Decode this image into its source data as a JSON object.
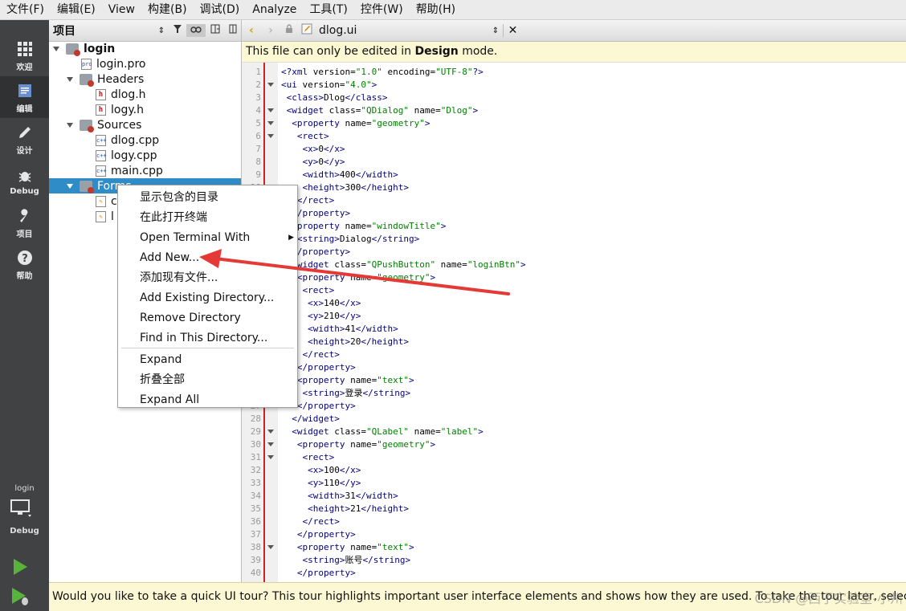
{
  "menubar": [
    "文件(F)",
    "编辑(E)",
    "View",
    "构建(B)",
    "调试(D)",
    "Analyze",
    "工具(T)",
    "控件(W)",
    "帮助(H)"
  ],
  "modes": [
    {
      "label": "欢迎",
      "icon": "grid-icon"
    },
    {
      "label": "编辑",
      "icon": "edit-icon"
    },
    {
      "label": "设计",
      "icon": "pencil-icon"
    },
    {
      "label": "Debug",
      "icon": "bug-icon"
    },
    {
      "label": "项目",
      "icon": "wrench-icon"
    },
    {
      "label": "帮助",
      "icon": "help-icon"
    }
  ],
  "kit": {
    "project": "login",
    "config": "Debug"
  },
  "project_pane": {
    "title": "项目"
  },
  "tree": [
    {
      "label": "login",
      "kind": "project"
    },
    {
      "label": "login.pro",
      "kind": "pro"
    },
    {
      "label": "Headers",
      "kind": "folder"
    },
    {
      "label": "dlog.h",
      "kind": "h"
    },
    {
      "label": "logy.h",
      "kind": "h"
    },
    {
      "label": "Sources",
      "kind": "folder"
    },
    {
      "label": "dlog.cpp",
      "kind": "cpp"
    },
    {
      "label": "logy.cpp",
      "kind": "cpp"
    },
    {
      "label": "main.cpp",
      "kind": "cpp"
    },
    {
      "label": "Forms",
      "kind": "folder"
    },
    {
      "label": "c",
      "kind": "ui"
    },
    {
      "label": "l",
      "kind": "ui"
    }
  ],
  "editor_tab": {
    "filename": "dlog.ui"
  },
  "infobar": {
    "prefix": "This file can only be edited in ",
    "bold": "Design",
    "suffix": " mode."
  },
  "context_menu": [
    "显示包含的目录",
    "在此打开终端",
    "Open Terminal With",
    "Add New...",
    "添加现有文件...",
    "Add Existing Directory...",
    "Remove Directory",
    "Find in This Directory...",
    "Expand",
    "折叠全部",
    "Expand All"
  ],
  "code_lines": [
    "<?xml version=\"1.0\" encoding=\"UTF-8\"?>",
    "<ui version=\"4.0\">",
    " <class>Dlog</class>",
    " <widget class=\"QDialog\" name=\"Dlog\">",
    "  <property name=\"geometry\">",
    "   <rect>",
    "    <x>0</x>",
    "    <y>0</y>",
    "    <width>400</width>",
    "    <height>300</height>",
    "   </rect>",
    "  </property>",
    "  <property name=\"windowTitle\">",
    "   <string>Dialog</string>",
    "  </property>",
    "  <widget class=\"QPushButton\" name=\"loginBtn\">",
    "   <property name=\"geometry\">",
    "    <rect>",
    "     <x>140</x>",
    "     <y>210</y>",
    "     <width>41</width>",
    "     <height>20</height>",
    "    </rect>",
    "   </property>",
    "   <property name=\"text\">",
    "    <string>登录</string>",
    "   </property>",
    "  </widget>",
    "  <widget class=\"QLabel\" name=\"label\">",
    "   <property name=\"geometry\">",
    "    <rect>",
    "     <x>100</x>",
    "     <y>110</y>",
    "     <width>31</width>",
    "     <height>21</height>",
    "    </rect>",
    "   </property>",
    "   <property name=\"text\">",
    "    <string>账号</string>",
    "   </property>"
  ],
  "tour_text": "Would you like to take a quick UI tour? This tour highlights important user interface elements and shows how they are used. To take the tour later, select Help",
  "watermark": "CSDN @西子实验室-小州",
  "colors": {
    "accent": "#308cc6",
    "arrow": "#e53935",
    "modebar": "#404244"
  }
}
